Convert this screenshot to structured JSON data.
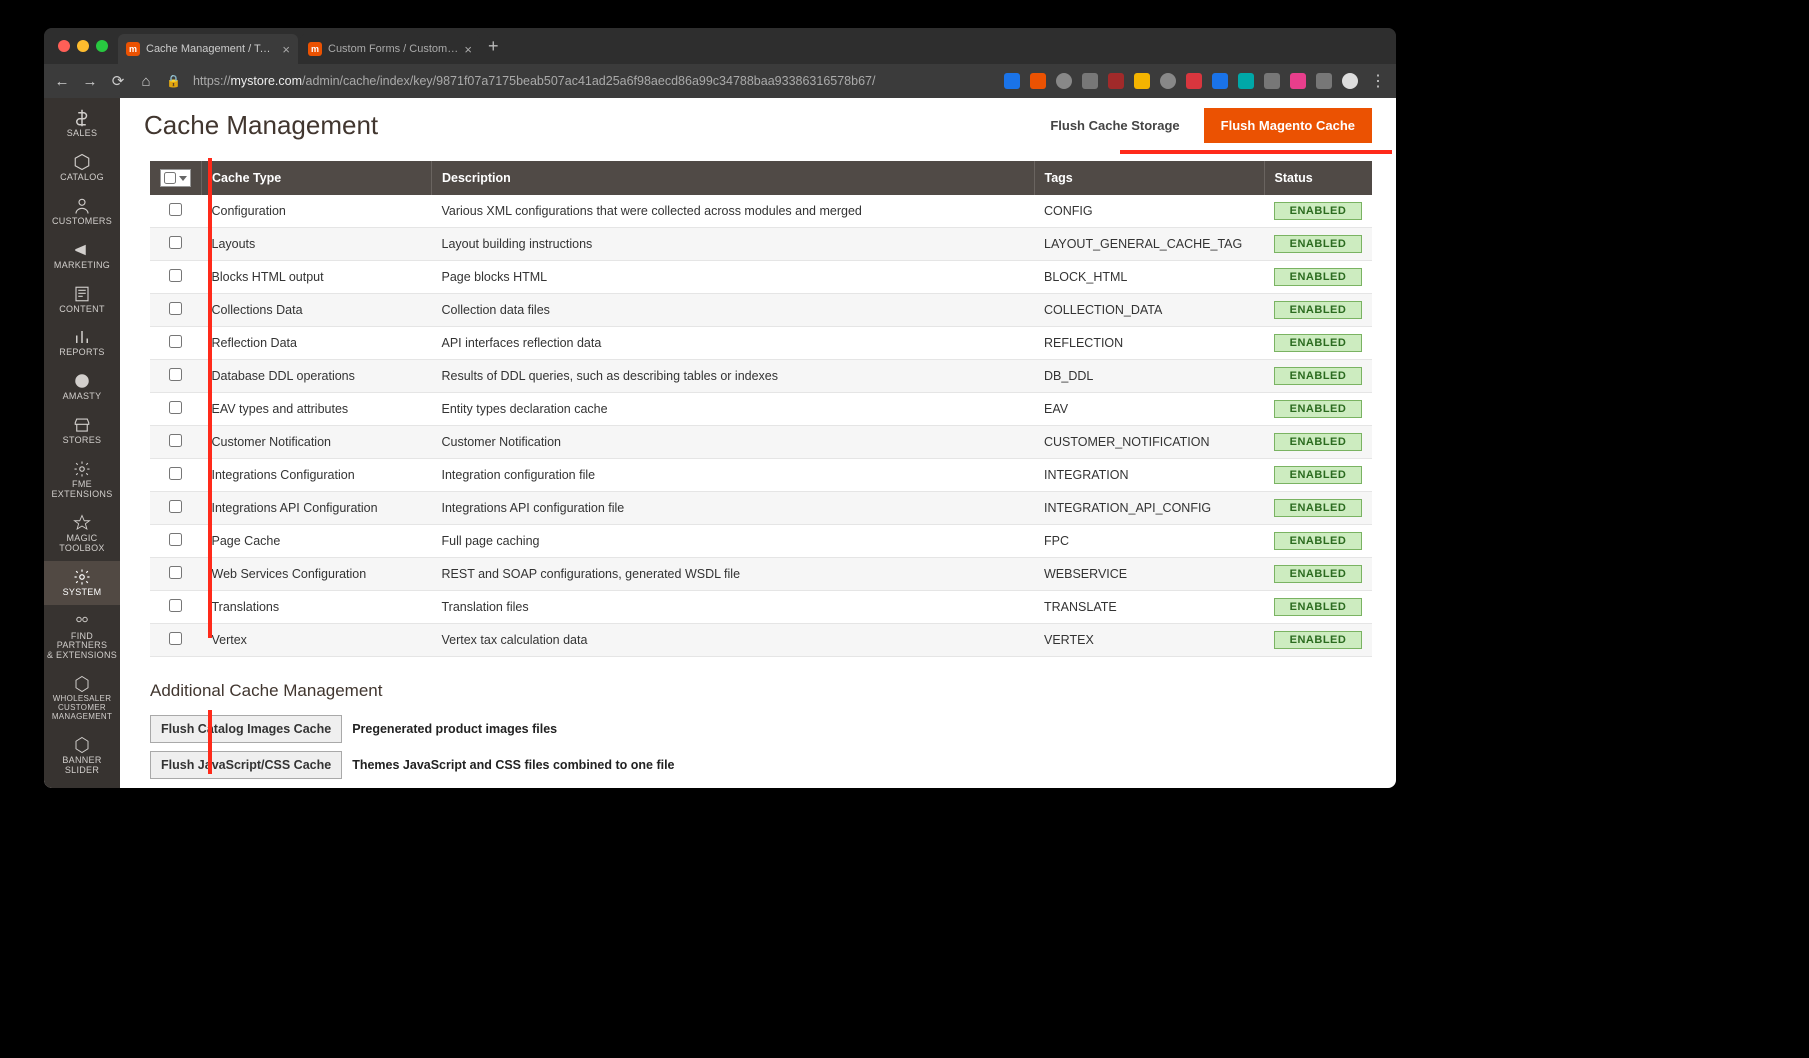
{
  "browser": {
    "tabs": [
      {
        "title": "Cache Management / Tools / S…"
      },
      {
        "title": "Custom Forms / Custom Forms…"
      }
    ],
    "url_prefix": "https://",
    "url_host": "mystore.com",
    "url_path": "/admin/cache/index/key/9871f07a7175beab507ac41ad25a6f98aecd86a99c34788baa93386316578b67/"
  },
  "nav": [
    {
      "label": "SALES"
    },
    {
      "label": "CATALOG"
    },
    {
      "label": "CUSTOMERS"
    },
    {
      "label": "MARKETING"
    },
    {
      "label": "CONTENT"
    },
    {
      "label": "REPORTS"
    },
    {
      "label": "AMASTY"
    },
    {
      "label": "STORES"
    },
    {
      "label": "FME\nEXTENSIONS"
    },
    {
      "label": "MAGIC\nTOOLBOX"
    },
    {
      "label": "SYSTEM"
    },
    {
      "label": "FIND PARTNERS\n& EXTENSIONS"
    },
    {
      "label": "WHOLESALER\nCUSTOMER\nMANAGEMENT"
    },
    {
      "label": "BANNER SLIDER"
    }
  ],
  "page": {
    "title": "Cache Management",
    "flush_storage": "Flush Cache Storage",
    "flush_magento": "Flush Magento Cache"
  },
  "columns": {
    "type": "Cache Type",
    "desc": "Description",
    "tags": "Tags",
    "status": "Status"
  },
  "rows": [
    {
      "type": "Configuration",
      "desc": "Various XML configurations that were collected across modules and merged",
      "tags": "CONFIG",
      "status": "ENABLED"
    },
    {
      "type": "Layouts",
      "desc": "Layout building instructions",
      "tags": "LAYOUT_GENERAL_CACHE_TAG",
      "status": "ENABLED"
    },
    {
      "type": "Blocks HTML output",
      "desc": "Page blocks HTML",
      "tags": "BLOCK_HTML",
      "status": "ENABLED"
    },
    {
      "type": "Collections Data",
      "desc": "Collection data files",
      "tags": "COLLECTION_DATA",
      "status": "ENABLED"
    },
    {
      "type": "Reflection Data",
      "desc": "API interfaces reflection data",
      "tags": "REFLECTION",
      "status": "ENABLED"
    },
    {
      "type": "Database DDL operations",
      "desc": "Results of DDL queries, such as describing tables or indexes",
      "tags": "DB_DDL",
      "status": "ENABLED"
    },
    {
      "type": "EAV types and attributes",
      "desc": "Entity types declaration cache",
      "tags": "EAV",
      "status": "ENABLED"
    },
    {
      "type": "Customer Notification",
      "desc": "Customer Notification",
      "tags": "CUSTOMER_NOTIFICATION",
      "status": "ENABLED"
    },
    {
      "type": "Integrations Configuration",
      "desc": "Integration configuration file",
      "tags": "INTEGRATION",
      "status": "ENABLED"
    },
    {
      "type": "Integrations API Configuration",
      "desc": "Integrations API configuration file",
      "tags": "INTEGRATION_API_CONFIG",
      "status": "ENABLED"
    },
    {
      "type": "Page Cache",
      "desc": "Full page caching",
      "tags": "FPC",
      "status": "ENABLED"
    },
    {
      "type": "Web Services Configuration",
      "desc": "REST and SOAP configurations, generated WSDL file",
      "tags": "WEBSERVICE",
      "status": "ENABLED"
    },
    {
      "type": "Translations",
      "desc": "Translation files",
      "tags": "TRANSLATE",
      "status": "ENABLED"
    },
    {
      "type": "Vertex",
      "desc": "Vertex tax calculation data",
      "tags": "VERTEX",
      "status": "ENABLED"
    }
  ],
  "additional": {
    "heading": "Additional Cache Management",
    "items": [
      {
        "button": "Flush Catalog Images Cache",
        "desc": "Pregenerated product images files"
      },
      {
        "button": "Flush JavaScript/CSS Cache",
        "desc": "Themes JavaScript and CSS files combined to one file"
      }
    ]
  }
}
